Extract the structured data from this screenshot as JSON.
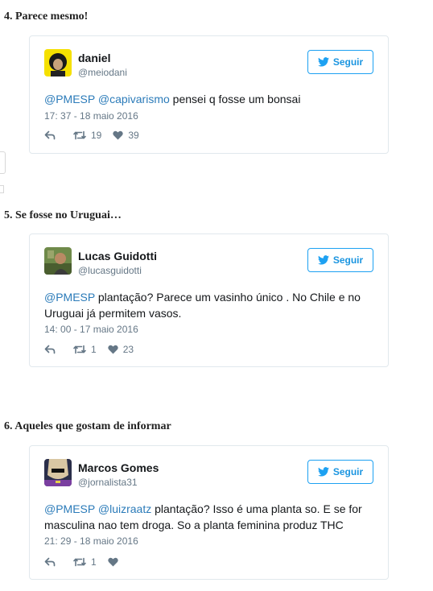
{
  "sections": [
    {
      "heading": "4. Parece mesmo!",
      "tweet": {
        "name": "daniel",
        "handle": "@meiodani",
        "follow_label": "Seguir",
        "text_parts": [
          {
            "text": "@PMESP",
            "link": true
          },
          {
            "text": " ",
            "link": false
          },
          {
            "text": "@capivarismo",
            "link": true
          },
          {
            "text": " pensei q fosse um bonsai",
            "link": false
          }
        ],
        "timestamp": "17: 37 - 18 maio 2016",
        "retweets": "19",
        "likes": "39"
      }
    },
    {
      "heading": "5. Se fosse no Uruguai…",
      "tweet": {
        "name": "Lucas Guidotti",
        "handle": "@lucasguidotti",
        "follow_label": "Seguir",
        "text_parts": [
          {
            "text": "@PMESP",
            "link": true
          },
          {
            "text": " plantação? Parece um vasinho único . No Chile e no Uruguai já permitem vasos.",
            "link": false
          }
        ],
        "timestamp": "14: 00 - 17 maio 2016",
        "retweets": "1",
        "likes": "23"
      }
    },
    {
      "heading": "6. Aqueles que gostam de informar",
      "tweet": {
        "name": "Marcos Gomes",
        "handle": "@jornalista31",
        "follow_label": "Seguir",
        "text_parts": [
          {
            "text": "@PMESP",
            "link": true
          },
          {
            "text": " ",
            "link": false
          },
          {
            "text": "@luizraatz",
            "link": true
          },
          {
            "text": " plantação? Isso é uma planta so. E se for masculina nao tem droga. So a planta feminina produz THC",
            "link": false
          }
        ],
        "timestamp": "21: 29 - 18 maio 2016",
        "retweets": "1",
        "likes": ""
      }
    }
  ],
  "icons": {
    "follow": "bird-icon",
    "reply": "reply-icon",
    "retweet": "retweet-icon",
    "like": "heart-icon"
  },
  "colors": {
    "link": "#2b7bb9",
    "follow_accent": "#1da1f2",
    "meta_gray": "#657786",
    "card_border": "#e1e8ed"
  }
}
